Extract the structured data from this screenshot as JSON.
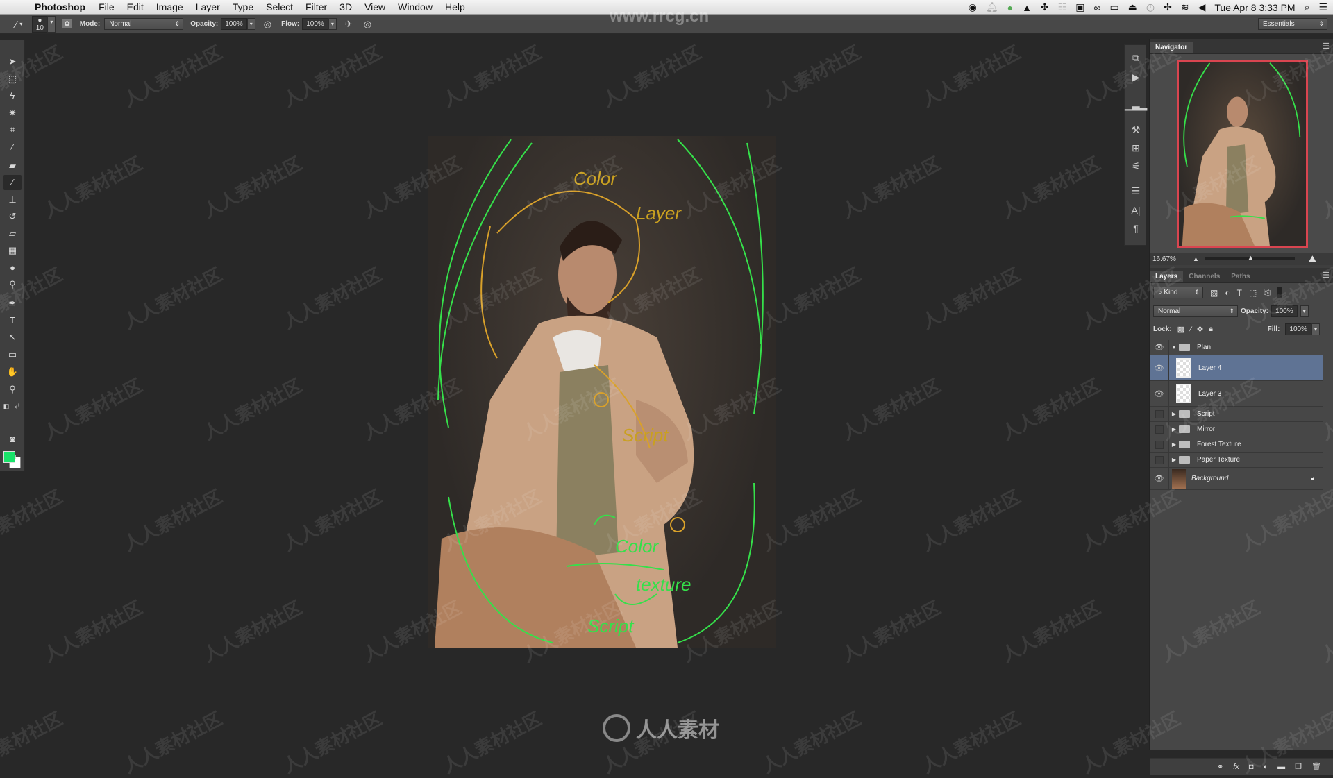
{
  "menubar": {
    "app": "Photoshop",
    "items": [
      "File",
      "Edit",
      "Image",
      "Layer",
      "Type",
      "Select",
      "Filter",
      "3D",
      "View",
      "Window",
      "Help"
    ],
    "clock": "Tue Apr 8  3:33 PM"
  },
  "options": {
    "brush_size": "10",
    "mode_label": "Mode:",
    "mode_value": "Normal",
    "opacity_label": "Opacity:",
    "opacity_value": "100%",
    "flow_label": "Flow:",
    "flow_value": "100%",
    "workspace": "Essentials"
  },
  "watermark": {
    "top": "www.rrcg.cn",
    "bottom": "人人素材",
    "tile": "人人素材社区"
  },
  "colors": {
    "foreground": "#19e36a",
    "background": "#ffffff",
    "selection": "#5f7394",
    "nav_frame": "#d94550"
  },
  "navigator": {
    "title": "Navigator",
    "zoom": "16.67%"
  },
  "layers_panel": {
    "tabs": [
      "Layers",
      "Channels",
      "Paths"
    ],
    "filter": "Kind",
    "blend_mode": "Normal",
    "opacity_label": "Opacity:",
    "opacity": "100%",
    "lock_label": "Lock:",
    "fill_label": "Fill:",
    "fill": "100%",
    "layers": [
      {
        "name": "Plan",
        "type": "group",
        "visible": true,
        "expanded": true
      },
      {
        "name": "Layer 4",
        "type": "layer",
        "visible": true,
        "selected": true
      },
      {
        "name": "Layer 3",
        "type": "layer",
        "visible": true
      },
      {
        "name": "Script",
        "type": "group",
        "visible": false
      },
      {
        "name": "Mirror",
        "type": "group",
        "visible": false
      },
      {
        "name": "Forest Texture",
        "type": "group",
        "visible": false
      },
      {
        "name": "Paper Texture",
        "type": "group",
        "visible": false
      },
      {
        "name": "Background",
        "type": "background",
        "visible": true,
        "locked": true
      }
    ]
  },
  "canvas_annotations": [
    "Color",
    "Layer",
    "Script",
    "Color",
    "texture",
    "Script"
  ]
}
